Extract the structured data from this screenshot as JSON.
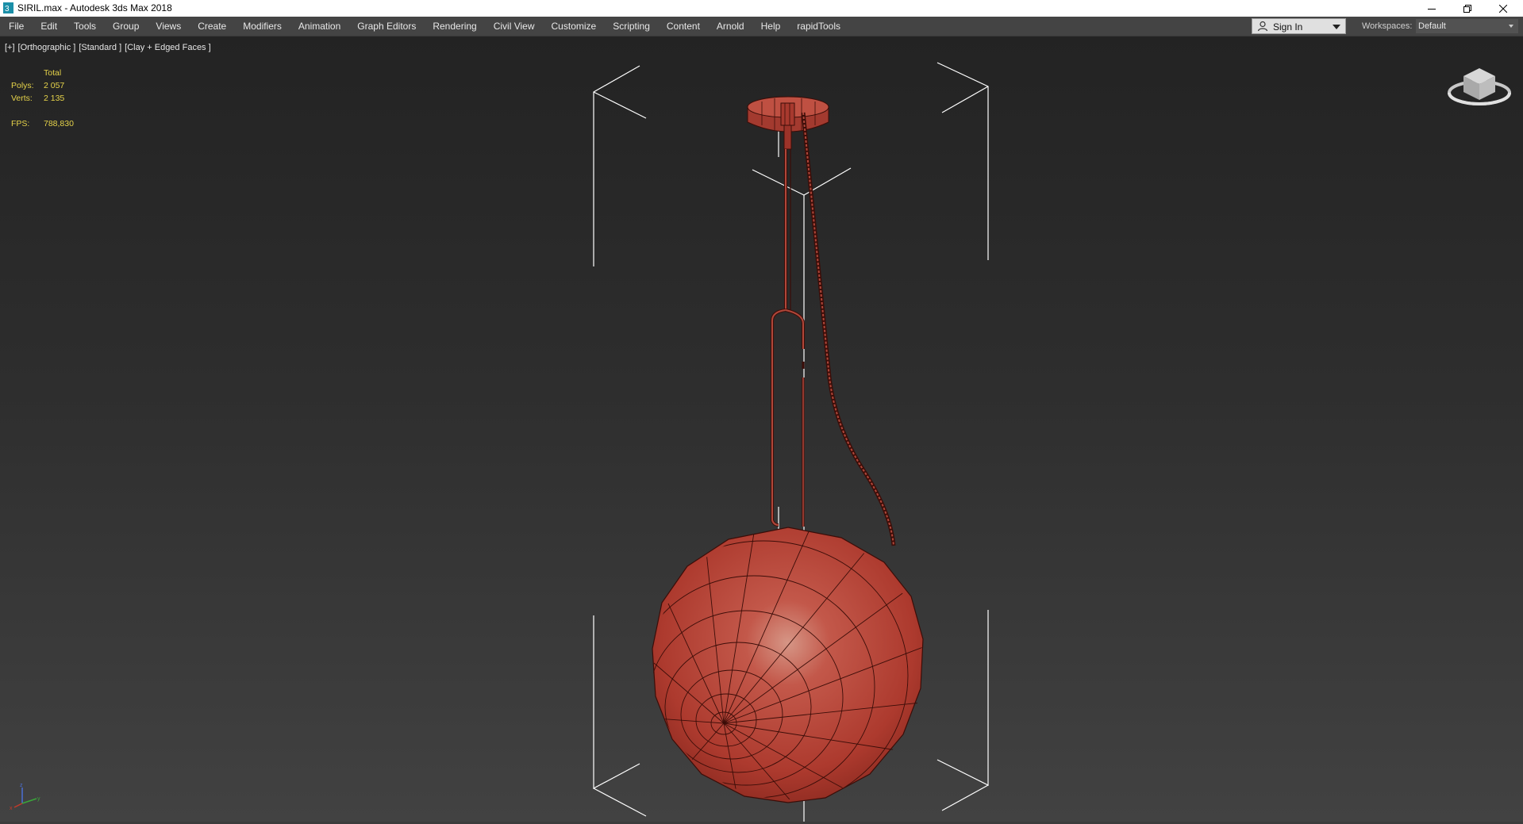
{
  "window": {
    "title": "SIRIL.max - Autodesk 3ds Max 2018",
    "app_icon": "3dsmax-icon",
    "controls": [
      "minimize-icon",
      "restore-icon",
      "close-icon"
    ]
  },
  "menubar": {
    "items": [
      "File",
      "Edit",
      "Tools",
      "Group",
      "Views",
      "Create",
      "Modifiers",
      "Animation",
      "Graph Editors",
      "Rendering",
      "Civil View",
      "Customize",
      "Scripting",
      "Content",
      "Arnold",
      "Help",
      "rapidTools"
    ],
    "sign_in": "Sign In",
    "workspaces_label": "Workspaces:",
    "workspace_value": "Default"
  },
  "viewport": {
    "labels": [
      "[+]",
      "[Orthographic ]",
      "[Standard ]",
      "[Clay + Edged Faces ]"
    ],
    "stats": {
      "header": "Total",
      "polys_label": "Polys:",
      "polys_value": "2 057",
      "verts_label": "Verts:",
      "verts_value": "2 135",
      "fps_label": "FPS:",
      "fps_value": "788,830"
    },
    "object_color": "#b8463a",
    "wire_color": "#3b0d08"
  }
}
